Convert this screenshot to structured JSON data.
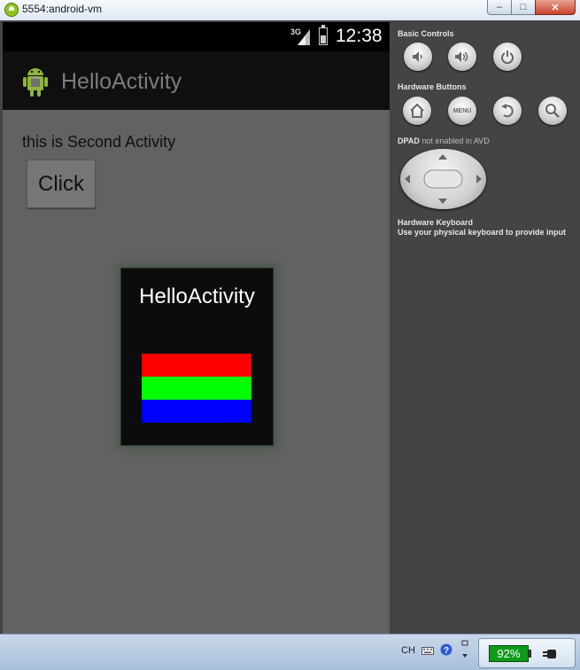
{
  "window": {
    "title": "5554:android-vm",
    "minimize_label": "–",
    "maximize_label": "□",
    "close_label": "✕"
  },
  "device": {
    "status": {
      "network": "3G",
      "clock": "12:38"
    },
    "action_bar": {
      "title": "HelloActivity",
      "icon": "android-robot-icon"
    },
    "content": {
      "label": "this is Second Activity",
      "button_label": "Click"
    },
    "dialog": {
      "title": "HelloActivity",
      "color_bars": [
        "#ff0000",
        "#00ff00",
        "#0000ff"
      ]
    }
  },
  "controls": {
    "basic_controls": "Basic Controls",
    "hardware_buttons": "Hardware Buttons",
    "menu_label": "MENU",
    "dpad_label": "DPAD",
    "dpad_status": "not enabled in AVD",
    "keyboard_title": "Hardware Keyboard",
    "keyboard_note": "Use your physical keyboard to provide input"
  },
  "taskbar": {
    "language": "CH",
    "battery_percent": "92%"
  }
}
